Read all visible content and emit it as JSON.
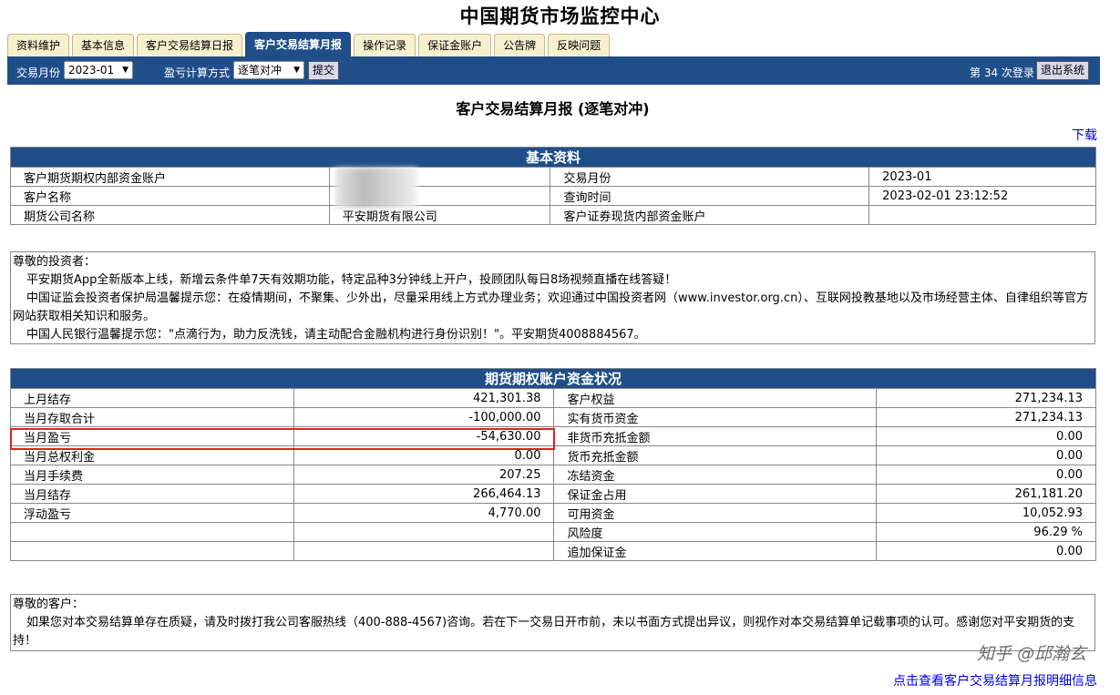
{
  "site_title": "中国期货市场监控中心",
  "tabs": [
    {
      "label": "资料维护",
      "active": false
    },
    {
      "label": "基本信息",
      "active": false
    },
    {
      "label": "客户交易结算日报",
      "active": false
    },
    {
      "label": "客户交易结算月报",
      "active": true
    },
    {
      "label": "操作记录",
      "active": false
    },
    {
      "label": "保证金账户",
      "active": false
    },
    {
      "label": "公告牌",
      "active": false
    },
    {
      "label": "反映问题",
      "active": false
    }
  ],
  "toolbar": {
    "month_label": "交易月份",
    "month_value": "2023-01",
    "method_label": "盈亏计算方式",
    "method_value": "逐笔对冲",
    "submit_label": "提交",
    "login_text": "第 34 次登录",
    "logout_label": "退出系统"
  },
  "page_heading": "客户交易结算月报 (逐笔对冲)",
  "download_label": "下载",
  "basic_info": {
    "title": "基本资料",
    "rows": [
      {
        "l1": "客户期货期权内部资金账户",
        "v1": "",
        "l2": "交易月份",
        "v2": "2023-01"
      },
      {
        "l1": "客户名称",
        "v1": "",
        "l2": "查询时间",
        "v2": "2023-02-01 23:12:52"
      },
      {
        "l1": "期货公司名称",
        "v1": "平安期货有限公司",
        "l2": "客户证券现货内部资金账户",
        "v2": ""
      }
    ]
  },
  "notice1": {
    "greeting": "尊敬的投资者：",
    "lines": [
      "平安期货App全新版本上线，新增云条件单7天有效期功能，特定品种3分钟线上开户，投顾团队每日8场视频直播在线答疑！",
      "中国证监会投资者保护局温馨提示您：在疫情期间，不聚集、少外出，尽量采用线上方式办理业务；欢迎通过中国投资者网（www.investor.org.cn）、互联网投教基地以及市场经营主体、自律组织等官方网站获取相关知识和服务。",
      "中国人民银行温馨提示您：\"点滴行为，助力反洗钱，请主动配合金融机构进行身份识别！\"。平安期货4008884567。"
    ]
  },
  "funds": {
    "title": "期货期权账户资金状况",
    "rows": [
      {
        "l1": "上月结存",
        "v1": "421,301.38",
        "l2": "客户权益",
        "v2": "271,234.13"
      },
      {
        "l1": "当月存取合计",
        "v1": "-100,000.00",
        "l2": "实有货币资金",
        "v2": "271,234.13"
      },
      {
        "l1": "当月盈亏",
        "v1": "-54,630.00",
        "l2": "非货币充抵金额",
        "v2": "0.00"
      },
      {
        "l1": "当月总权利金",
        "v1": "0.00",
        "l2": "货币充抵金额",
        "v2": "0.00"
      },
      {
        "l1": "当月手续费",
        "v1": "207.25",
        "l2": "冻结资金",
        "v2": "0.00"
      },
      {
        "l1": "当月结存",
        "v1": "266,464.13",
        "l2": "保证金占用",
        "v2": "261,181.20"
      },
      {
        "l1": "浮动盈亏",
        "v1": "4,770.00",
        "l2": "可用资金",
        "v2": "10,052.93"
      },
      {
        "l1": "",
        "v1": "",
        "l2": "风险度",
        "v2": "96.29 %"
      },
      {
        "l1": "",
        "v1": "",
        "l2": "追加保证金",
        "v2": "0.00"
      }
    ]
  },
  "notice2": {
    "greeting": "尊敬的客户：",
    "text": "如果您对本交易结算单存在质疑，请及时拨打我公司客服热线（400-888-4567)咨询。若在下一交易日开市前，未以书面方式提出异议，则视作对本交易结算单记载事项的认可。感谢您对平安期货的支持！"
  },
  "watermark": "知乎 @邱瀚玄",
  "footer_link": "点击查看客户交易结算月报明细信息",
  "colors": {
    "nav_blue": "#1f4e89",
    "tab_bg": "#f7f0cf",
    "highlight_red": "#e02020",
    "link_blue": "#0000ee"
  }
}
